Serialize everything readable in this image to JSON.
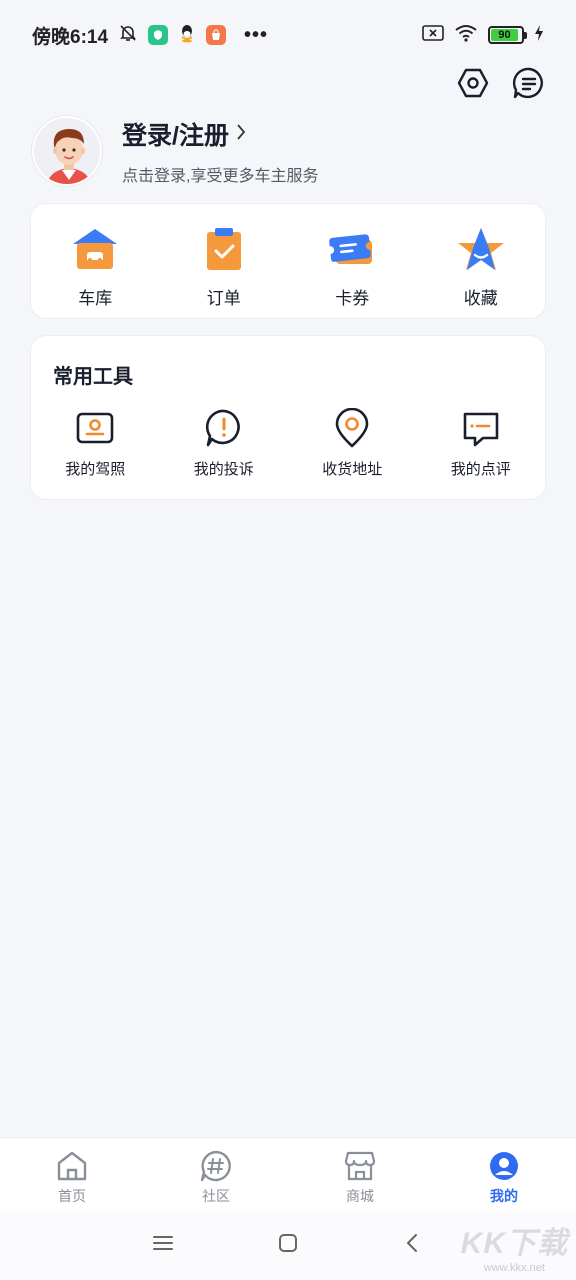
{
  "status_bar": {
    "time": "傍晚6:14",
    "battery": "90",
    "more": "•••"
  },
  "top_actions": {
    "settings_icon": "settings-hexagon-icon",
    "message_icon": "message-icon"
  },
  "profile": {
    "title": "登录/注册",
    "subtitle": "点击登录,享受更多车主服务"
  },
  "main_items": [
    {
      "label": "车库",
      "icon": "garage-icon"
    },
    {
      "label": "订单",
      "icon": "order-icon"
    },
    {
      "label": "卡券",
      "icon": "coupon-icon"
    },
    {
      "label": "收藏",
      "icon": "favorite-icon"
    }
  ],
  "tools": {
    "title": "常用工具",
    "items": [
      {
        "label": "我的驾照",
        "icon": "license-icon"
      },
      {
        "label": "我的投诉",
        "icon": "complaint-icon"
      },
      {
        "label": "收货地址",
        "icon": "location-icon"
      },
      {
        "label": "我的点评",
        "icon": "review-icon"
      }
    ]
  },
  "bottom_nav": [
    {
      "label": "首页",
      "icon": "home-icon",
      "active": false
    },
    {
      "label": "社区",
      "icon": "community-icon",
      "active": false
    },
    {
      "label": "商城",
      "icon": "store-icon",
      "active": false
    },
    {
      "label": "我的",
      "icon": "profile-icon",
      "active": true
    }
  ],
  "watermark": {
    "brand": "KK下载",
    "url": "www.kkx.net"
  },
  "colors": {
    "accent": "#2f6bf0",
    "orange": "#f08a2c",
    "text_dark": "#1a1f2e",
    "background": "#f5f6fa"
  }
}
